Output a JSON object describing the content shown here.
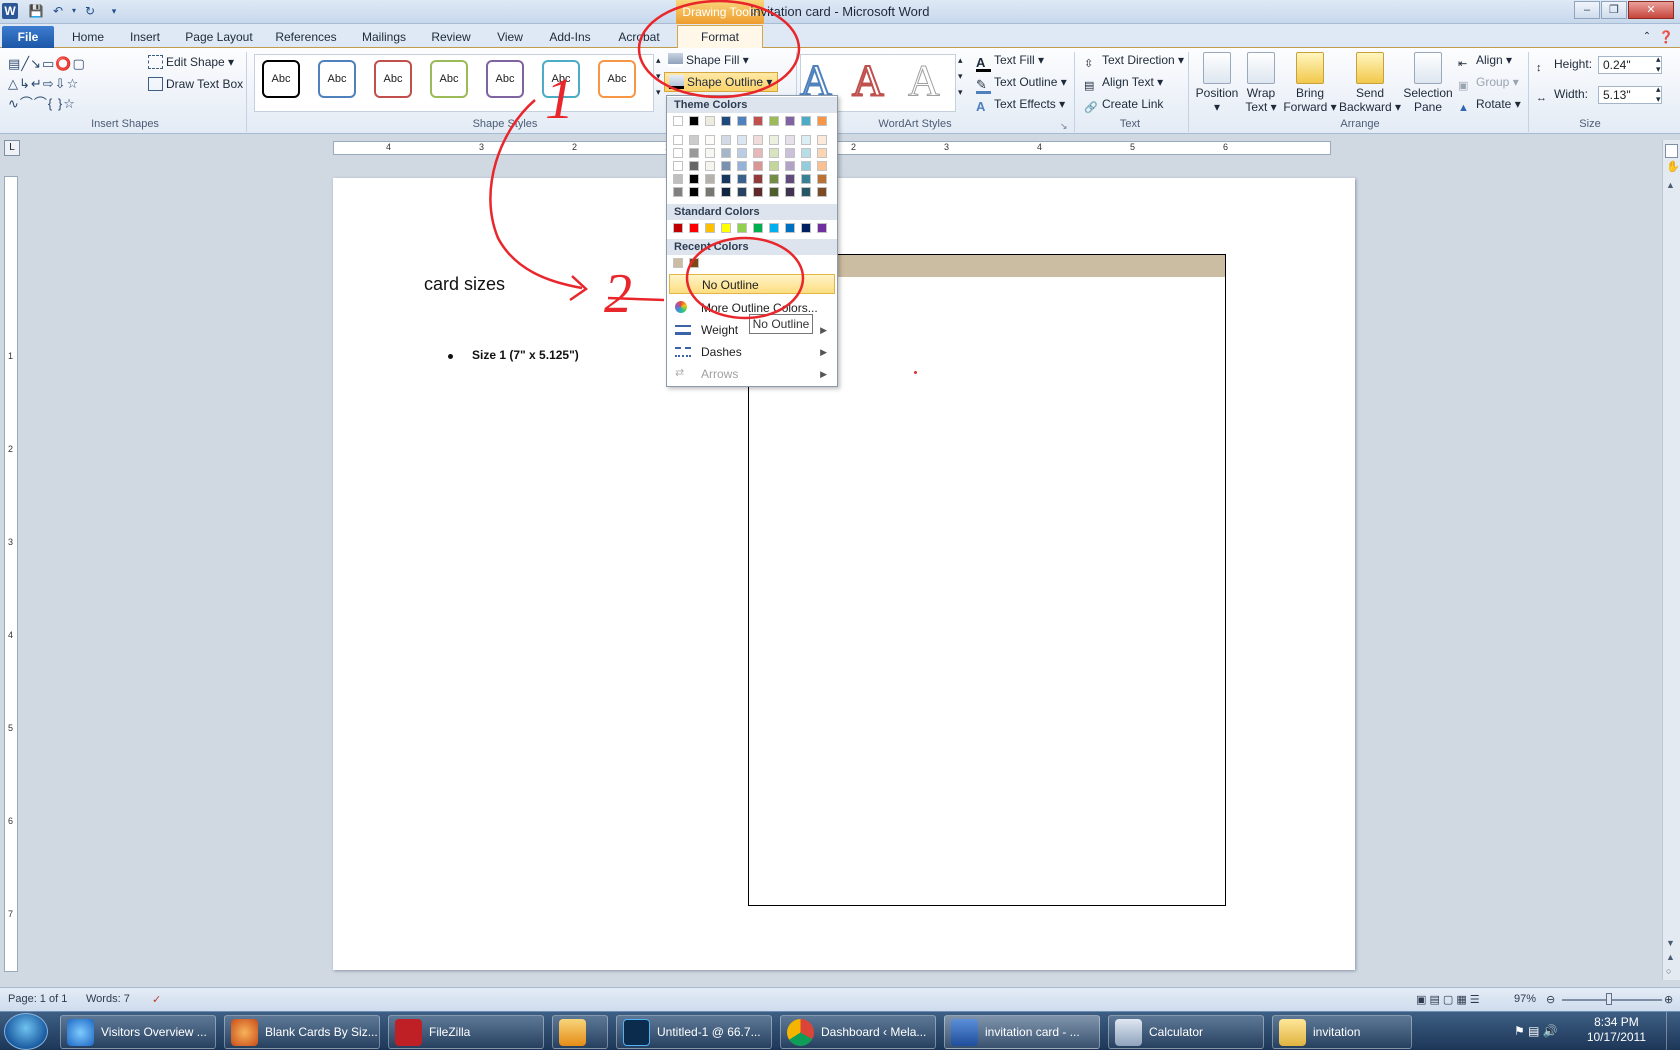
{
  "window": {
    "title": "invitation card  -  Microsoft Word",
    "contextual_tab_group": "Drawing Tools"
  },
  "tabs": [
    "File",
    "Home",
    "Insert",
    "Page Layout",
    "References",
    "Mailings",
    "Review",
    "View",
    "Add-Ins",
    "Acrobat",
    "Format"
  ],
  "ribbon": {
    "insert_shapes": {
      "edit_shape": "Edit Shape",
      "draw_text_box": "Draw Text Box",
      "label": "Insert Shapes"
    },
    "shape_styles": {
      "sample": "Abc",
      "shape_fill": "Shape Fill",
      "shape_outline": "Shape Outline",
      "label": "Shape Styles"
    },
    "wordart": {
      "text_fill": "Text Fill",
      "text_outline": "Text Outline",
      "text_effects": "Text Effects",
      "label": "WordArt Styles"
    },
    "text": {
      "text_direction": "Text Direction",
      "align_text": "Align Text",
      "create_link": "Create Link",
      "label": "Text"
    },
    "arrange": {
      "position": "Position",
      "wrap_text_1": "Wrap",
      "wrap_text_2": "Text",
      "bring_forward_1": "Bring",
      "bring_forward_2": "Forward",
      "send_backward_1": "Send",
      "send_backward_2": "Backward",
      "selection_pane_1": "Selection",
      "selection_pane_2": "Pane",
      "align": "Align",
      "group": "Group",
      "rotate": "Rotate",
      "label": "Arrange"
    },
    "size": {
      "height_label": "Height:",
      "height_value": "0.24\"",
      "width_label": "Width:",
      "width_value": "5.13\"",
      "label": "Size"
    }
  },
  "colors": {
    "theme_top": [
      "#ffffff",
      "#000000",
      "#eeece1",
      "#1f497d",
      "#4f81bd",
      "#c0504d",
      "#9bbb59",
      "#8064a2",
      "#4bacc6",
      "#f79646"
    ],
    "standard": [
      "#c00000",
      "#ff0000",
      "#ffc000",
      "#ffff00",
      "#92d050",
      "#00b050",
      "#00b0f0",
      "#0070c0",
      "#002060",
      "#7030a0"
    ],
    "recent": [
      "#cbbda2",
      "#7a4a14"
    ],
    "card_band": "#cbbda2",
    "annotation": "#e8262b"
  },
  "dropdown": {
    "theme_colors": "Theme Colors",
    "standard_colors": "Standard Colors",
    "recent_colors": "Recent Colors",
    "no_outline": "No Outline",
    "more_outline_colors": "More Outline Colors...",
    "weight": "Weight",
    "dashes": "Dashes",
    "arrows": "Arrows",
    "tooltip": "No Outline"
  },
  "document": {
    "heading": "card sizes",
    "bullet": "Size 1 (7\" x  5.125\")"
  },
  "annotations": {
    "step1": "1",
    "step2": "2"
  },
  "ruler": {
    "top_numbers": [
      "4",
      "3",
      "2",
      "1",
      "1",
      "2",
      "3",
      "4",
      "5",
      "6"
    ],
    "left_numbers": [
      "1",
      "2",
      "3",
      "4",
      "5",
      "6",
      "7"
    ]
  },
  "status": {
    "page": "Page: 1 of 1",
    "words": "Words: 7",
    "zoom": "97%"
  },
  "taskbar": {
    "items": [
      "Visitors Overview ...",
      "Blank Cards By Siz...",
      "FileZilla",
      "",
      "Untitled-1 @ 66.7...",
      "Dashboard ‹ Mela...",
      "invitation card - ...",
      "Calculator",
      "invitation"
    ],
    "time": "8:34 PM",
    "date": "10/17/2011"
  }
}
